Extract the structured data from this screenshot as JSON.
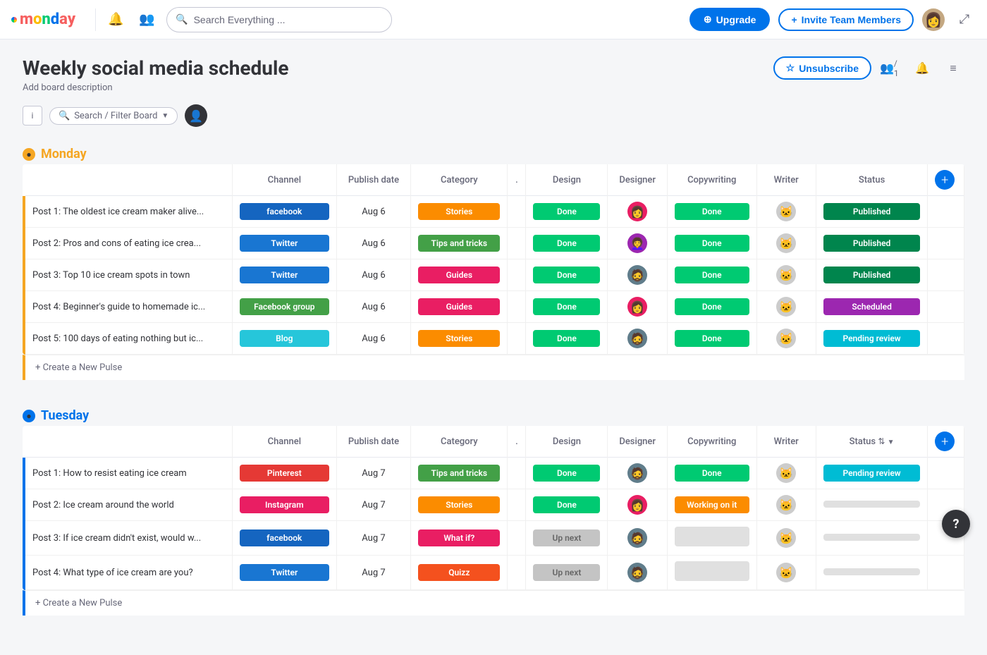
{
  "topnav": {
    "logo_alt": "monday.com",
    "search_placeholder": "Search Everything ...",
    "upgrade_label": "Upgrade",
    "invite_label": "Invite Team Members"
  },
  "page": {
    "title": "Weekly social media schedule",
    "description": "Add board description",
    "unsubscribe_label": "Unsubscribe",
    "members_count": "/ 1"
  },
  "toolbar": {
    "filter_placeholder": "Search / Filter Board",
    "info_label": "i"
  },
  "monday_group": {
    "title": "Monday",
    "color": "#f5a623",
    "columns": [
      "Channel",
      "Publish date",
      "Category",
      ".",
      "Design",
      "Designer",
      "Copywriting",
      "Writer",
      "Status"
    ],
    "rows": [
      {
        "title": "Post 1: The oldest ice cream maker alive...",
        "channel": "facebook",
        "channel_label": "facebook",
        "date": "Aug 6",
        "category": "Stories",
        "design": "Done",
        "designer": "av1",
        "copywriting": "Done",
        "writer": "avcat1",
        "status": "Published",
        "status_type": "published"
      },
      {
        "title": "Post 2: Pros and cons of eating ice crea...",
        "channel": "twitter",
        "channel_label": "Twitter",
        "date": "Aug 6",
        "category": "Tips and tricks",
        "design": "Done",
        "designer": "av2",
        "copywriting": "Done",
        "writer": "avcat2",
        "status": "Published",
        "status_type": "published"
      },
      {
        "title": "Post 3: Top 10 ice cream spots in town",
        "channel": "twitter",
        "channel_label": "Twitter",
        "date": "Aug 6",
        "category": "Guides",
        "design": "Done",
        "designer": "av3",
        "copywriting": "Done",
        "writer": "avcat3",
        "status": "Published",
        "status_type": "published"
      },
      {
        "title": "Post 4: Beginner's guide to homemade ic...",
        "channel": "fbgroup",
        "channel_label": "Facebook group",
        "date": "Aug 6",
        "category": "Guides",
        "design": "Done",
        "designer": "av1",
        "copywriting": "Done",
        "writer": "avcat2",
        "status": "Scheduled",
        "status_type": "scheduled"
      },
      {
        "title": "Post 5: 100 days of eating nothing but ic...",
        "channel": "blog",
        "channel_label": "Blog",
        "date": "Aug 6",
        "category": "Stories",
        "design": "Done",
        "designer": "av3",
        "copywriting": "Done",
        "writer": "avcat1",
        "status": "Pending review",
        "status_type": "pending"
      }
    ],
    "create_label": "+ Create a New Pulse"
  },
  "tuesday_group": {
    "title": "Tuesday",
    "color": "#0073ea",
    "columns": [
      "Channel",
      "Publish date",
      "Category",
      ".",
      "Design",
      "Designer",
      "Copywriting",
      "Writer",
      "Status"
    ],
    "rows": [
      {
        "title": "Post 1: How to resist eating ice cream",
        "channel": "pinterest",
        "channel_label": "Pinterest",
        "date": "Aug 7",
        "category": "Tips and tricks",
        "design": "Done",
        "designer": "av3",
        "copywriting": "Done",
        "writer": "avcat1",
        "status": "Pending review",
        "status_type": "pending"
      },
      {
        "title": "Post 2: Ice cream around the world",
        "channel": "instagram",
        "channel_label": "Instagram",
        "date": "Aug 7",
        "category": "Stories",
        "design": "Done",
        "designer": "av1",
        "copywriting": "Working on it",
        "writer": "avcat2",
        "status": "",
        "status_type": "empty"
      },
      {
        "title": "Post 3: If ice cream didn't exist, would w...",
        "channel": "facebook",
        "channel_label": "facebook",
        "date": "Aug 7",
        "category": "What if?",
        "design": "Up next",
        "designer": "av3",
        "copywriting": "",
        "writer": "avcat1",
        "status": "",
        "status_type": "empty"
      },
      {
        "title": "Post 4: What type of ice cream are you?",
        "channel": "twitter",
        "channel_label": "Twitter",
        "date": "Aug 7",
        "category": "Quizz",
        "design": "Up next",
        "designer": "av3",
        "copywriting": "",
        "writer": "avcat1",
        "status": "",
        "status_type": "empty"
      }
    ],
    "create_label": "+ Create a New Pulse"
  },
  "help": {
    "label": "?"
  }
}
